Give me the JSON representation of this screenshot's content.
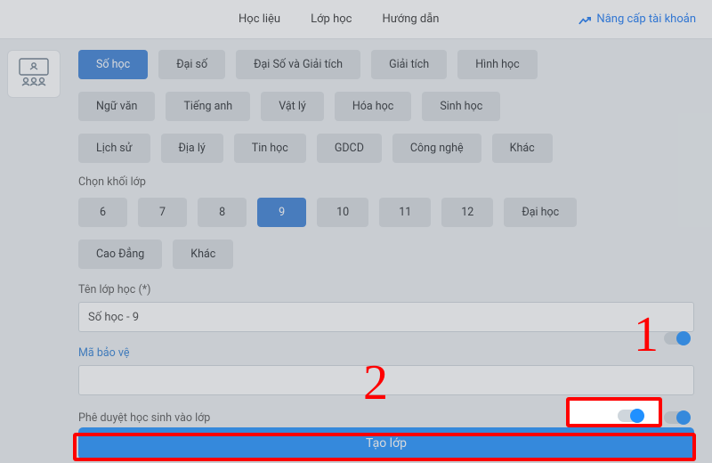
{
  "nav": {
    "tabs": [
      "Học liệu",
      "Lớp học",
      "Hướng dẫn"
    ],
    "upgrade": "Nâng cấp tài khoản"
  },
  "subjects": {
    "row1": [
      {
        "label": "Số học",
        "selected": true
      },
      {
        "label": "Đại số",
        "selected": false
      },
      {
        "label": "Đại Số và Giải tích",
        "selected": false
      },
      {
        "label": "Giải tích",
        "selected": false
      },
      {
        "label": "Hình học",
        "selected": false
      }
    ],
    "row2": [
      {
        "label": "Ngữ văn"
      },
      {
        "label": "Tiếng anh"
      },
      {
        "label": "Vật lý"
      },
      {
        "label": "Hóa học"
      },
      {
        "label": "Sinh học"
      }
    ],
    "row3": [
      {
        "label": "Lịch sử"
      },
      {
        "label": "Địa lý"
      },
      {
        "label": "Tin học"
      },
      {
        "label": "GDCD"
      },
      {
        "label": "Công nghệ"
      },
      {
        "label": "Khác"
      }
    ]
  },
  "grade": {
    "label": "Chọn khối lớp",
    "row1": [
      {
        "label": "6"
      },
      {
        "label": "7"
      },
      {
        "label": "8"
      },
      {
        "label": "9",
        "selected": true
      },
      {
        "label": "10"
      },
      {
        "label": "11"
      },
      {
        "label": "12"
      },
      {
        "label": "Đại học"
      }
    ],
    "row2": [
      {
        "label": "Cao Đẳng"
      },
      {
        "label": "Khác"
      }
    ]
  },
  "class_name": {
    "label": "Tên lớp học (*)",
    "value": "Số học - 9"
  },
  "protect_code": {
    "label": "Mã bảo vệ",
    "value": ""
  },
  "approve": {
    "label": "Phê duyệt học sinh vào lớp"
  },
  "create_button": "Tạo lớp",
  "annotations": {
    "one": "1",
    "two": "2"
  }
}
